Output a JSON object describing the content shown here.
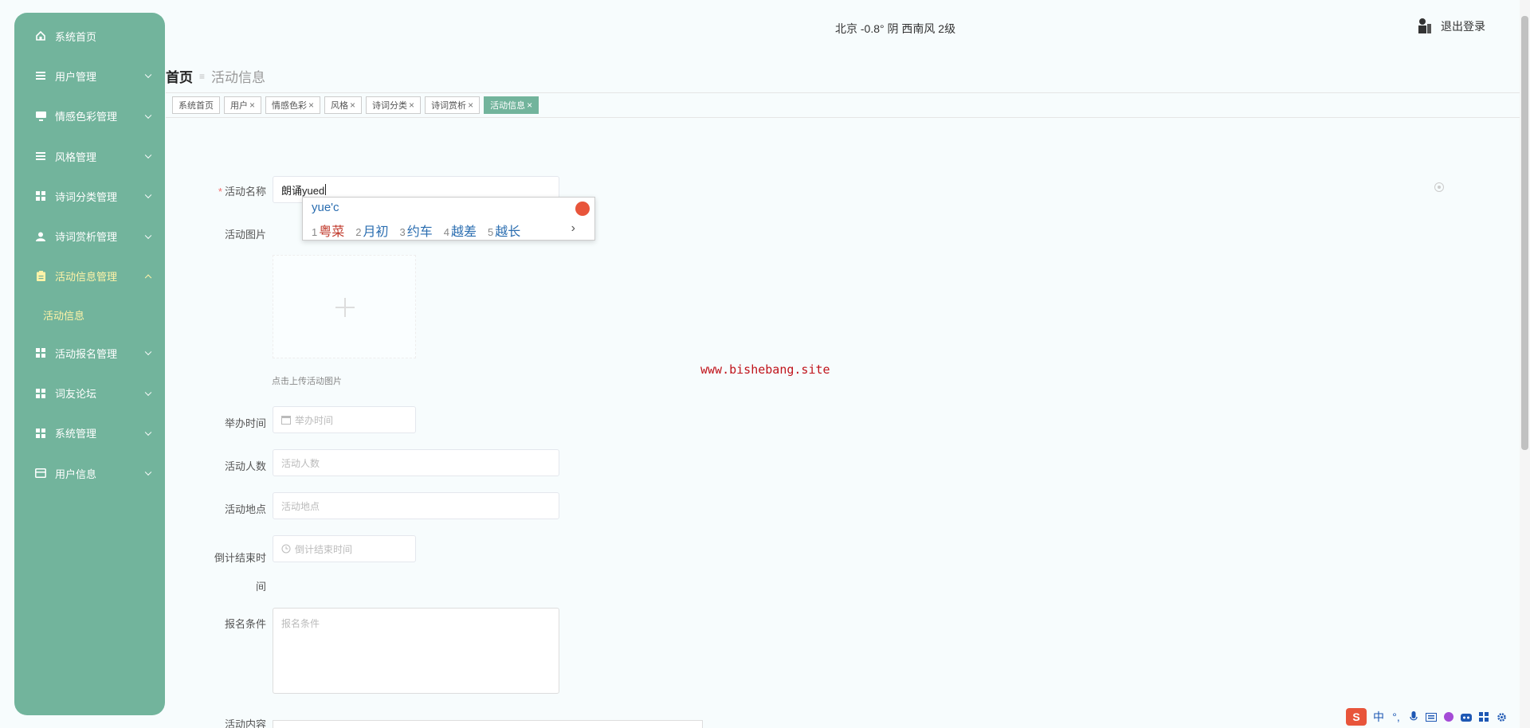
{
  "colors": {
    "accent": "#72b49c",
    "active_menu_text": "#fff3a8",
    "watermark": "#c0141b",
    "required": "#f56c6c"
  },
  "sidebar": {
    "items": [
      {
        "label": "系统首页",
        "icon": "home-icon"
      },
      {
        "label": "用户管理",
        "icon": "list-icon"
      },
      {
        "label": "情感色彩管理",
        "icon": "monitor-icon"
      },
      {
        "label": "风格管理",
        "icon": "list-icon"
      },
      {
        "label": "诗词分类管理",
        "icon": "grid-icon"
      },
      {
        "label": "诗词赏析管理",
        "icon": "user-icon"
      },
      {
        "label": "活动信息管理",
        "icon": "clipboard-icon"
      },
      {
        "label": "活动报名管理",
        "icon": "grid-icon"
      },
      {
        "label": "词友论坛",
        "icon": "grid-icon"
      },
      {
        "label": "系统管理",
        "icon": "grid-icon"
      },
      {
        "label": "用户信息",
        "icon": "card-icon"
      }
    ],
    "active_sub": "活动信息"
  },
  "header": {
    "weather": "北京  -0.8°  阴  西南风  2级",
    "logout": "退出登录"
  },
  "breadcrumb": {
    "home": "首页",
    "separator": "≡",
    "current": "活动信息"
  },
  "tags": [
    {
      "label": "系统首页",
      "closable": false
    },
    {
      "label": "用户",
      "closable": true
    },
    {
      "label": "情感色彩",
      "closable": true
    },
    {
      "label": "风格",
      "closable": true
    },
    {
      "label": "诗词分类",
      "closable": true
    },
    {
      "label": "诗词赏析",
      "closable": true
    },
    {
      "label": "活动信息",
      "closable": true,
      "active": true
    }
  ],
  "form": {
    "name_label": "活动名称",
    "name_value": "朗诵yued",
    "image_label": "活动图片",
    "upload_hint": "点击上传活动图片",
    "time_label": "举办时间",
    "time_placeholder": "举办时间",
    "count_label": "活动人数",
    "count_placeholder": "活动人数",
    "place_label": "活动地点",
    "place_placeholder": "活动地点",
    "countdown_label_1": "倒计结束时",
    "countdown_label_2": "间",
    "countdown_placeholder": "倒计结束时间",
    "condition_label": "报名条件",
    "condition_placeholder": "报名条件",
    "content_label": "活动内容"
  },
  "ime": {
    "composition": "yue'c",
    "candidates": [
      {
        "n": "1",
        "text": "粤菜"
      },
      {
        "n": "2",
        "text": "月初"
      },
      {
        "n": "3",
        "text": "约车"
      },
      {
        "n": "4",
        "text": "越差"
      },
      {
        "n": "5",
        "text": "越长"
      }
    ],
    "next": "›"
  },
  "watermark": "www.bishebang.site",
  "tray": {
    "ime_mode": "中",
    "punct": "°,"
  }
}
